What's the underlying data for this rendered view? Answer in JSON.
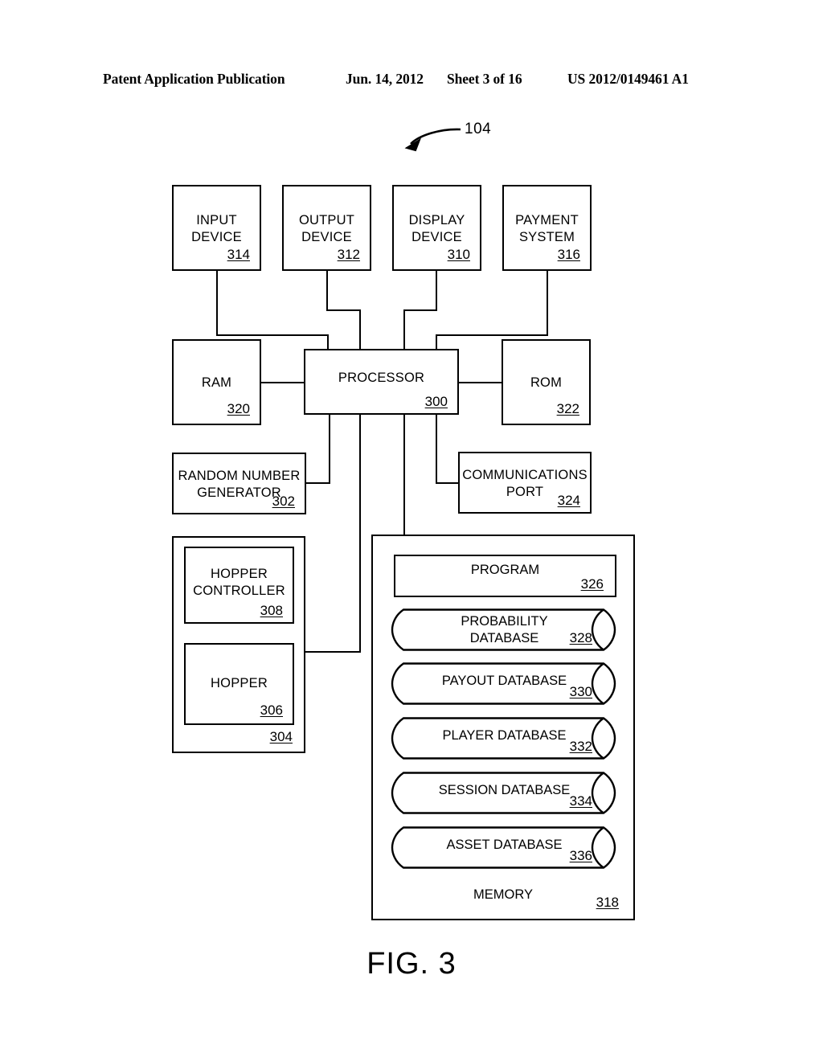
{
  "header": {
    "publication": "Patent Application Publication",
    "date": "Jun. 14, 2012",
    "sheet": "Sheet 3 of 16",
    "number": "US 2012/0149461 A1"
  },
  "figure": {
    "caption": "FIG. 3",
    "callout": "104"
  },
  "blocks": {
    "input_device": {
      "line1": "INPUT",
      "line2": "DEVICE",
      "ref": "314"
    },
    "output_device": {
      "line1": "OUTPUT",
      "line2": "DEVICE",
      "ref": "312"
    },
    "display_device": {
      "line1": "DISPLAY",
      "line2": "DEVICE",
      "ref": "310"
    },
    "payment_system": {
      "line1": "PAYMENT",
      "line2": "SYSTEM",
      "ref": "316"
    },
    "ram": {
      "line1": "RAM",
      "ref": "320"
    },
    "processor": {
      "line1": "PROCESSOR",
      "ref": "300"
    },
    "rom": {
      "line1": "ROM",
      "ref": "322"
    },
    "rng": {
      "line1": "RANDOM NUMBER",
      "line2": "GENERATOR",
      "ref": "302"
    },
    "comm_port": {
      "line1": "COMMUNICATIONS",
      "line2": "PORT",
      "ref": "324"
    },
    "hopper_assembly": {
      "ref": "304"
    },
    "hopper_controller": {
      "line1": "HOPPER",
      "line2": "CONTROLLER",
      "ref": "308"
    },
    "hopper": {
      "line1": "HOPPER",
      "ref": "306"
    },
    "memory": {
      "label": "MEMORY",
      "ref": "318"
    },
    "program": {
      "label": "PROGRAM",
      "ref": "326"
    }
  },
  "databases": [
    {
      "line1": "PROBABILITY",
      "line2": "DATABASE",
      "ref": "328"
    },
    {
      "line1": "PAYOUT DATABASE",
      "ref": "330"
    },
    {
      "line1": "PLAYER DATABASE",
      "ref": "332"
    },
    {
      "line1": "SESSION DATABASE",
      "ref": "334"
    },
    {
      "line1": "ASSET DATABASE",
      "ref": "336"
    }
  ],
  "colors": {
    "ink": "#000000",
    "paper": "#ffffff"
  }
}
